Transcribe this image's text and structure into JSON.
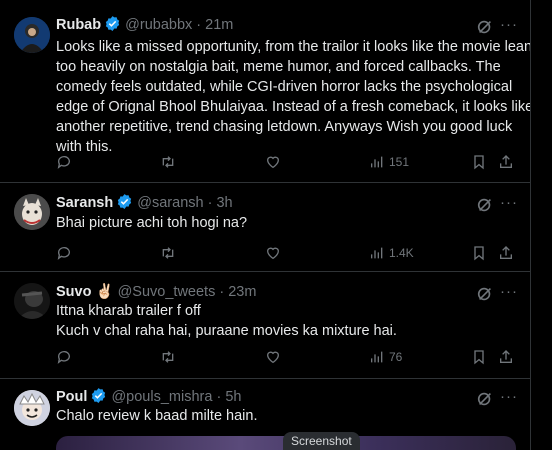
{
  "tweets": [
    {
      "name": "Rubab",
      "handle": "@rubabbx",
      "time": "21m",
      "lines": [
        "Looks like a missed opportunity, from the trailor it looks like the movie leans",
        "too heavily on nostalgia bait, meme humor, and forced callbacks. The",
        "comedy feels outdated, while CGI-driven horror lacks the psychological",
        "edge of Orignal Bhool Bhulaiyaa. Instead of a fresh comeback, it looks like",
        "another repetitive, trend chasing letdown. Anyways Wish you good luck",
        "with this."
      ],
      "views": "151"
    },
    {
      "name": "Saransh",
      "handle": "@saransh",
      "time": "3h",
      "lines": [
        "Bhai picture achi toh hogi na?"
      ],
      "views": "1.4K"
    },
    {
      "name": "Suvo",
      "emoji": "✌🏻",
      "handle": "@Suvo_tweets",
      "time": "23m",
      "lines": [
        "Ittna kharab trailer f off",
        "Kuch v chal raha hai, puraane movies ka mixture hai."
      ],
      "views": "76"
    },
    {
      "name": "Poul",
      "handle": "@pouls_mishra",
      "time": "5h",
      "lines": [
        "Chalo review k baad milte hain."
      ]
    }
  ],
  "dot": "·",
  "more_glyph": "···",
  "overlay": {
    "label": "Screenshot"
  },
  "icons": [
    "reply-icon",
    "retweet-icon",
    "like-icon",
    "views-icon",
    "bookmark-icon",
    "share-icon",
    "grok-icon",
    "more-icon",
    "verified-badge-icon"
  ],
  "colors": {
    "background": "#000000",
    "text": "#e7e9ea",
    "muted": "#71767b",
    "verified": "#1d9bf0",
    "border": "#2f3336"
  }
}
